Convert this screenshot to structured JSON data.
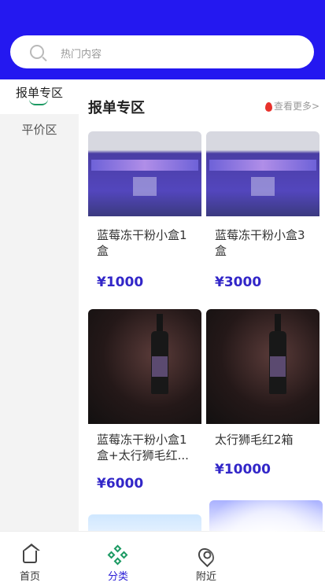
{
  "search": {
    "placeholder": "热门内容"
  },
  "sidebar": {
    "items": [
      {
        "label": "报单专区",
        "active": true
      },
      {
        "label": "平价区",
        "active": false
      }
    ]
  },
  "section": {
    "title": "报单专区",
    "more": "查看更多>"
  },
  "products": [
    {
      "title": "蓝莓冻干粉小盒1盒",
      "price": "¥1000"
    },
    {
      "title": "蓝莓冻干粉小盒3盒",
      "price": "¥3000"
    },
    {
      "title": "蓝莓冻干粉小盒1盒+太行狮毛红...",
      "price": "¥6000"
    },
    {
      "title": "太行狮毛红2箱",
      "price": "¥10000"
    }
  ],
  "tabbar": {
    "items": [
      {
        "label": "首页",
        "icon": "home-icon"
      },
      {
        "label": "分类",
        "icon": "category-icon",
        "active": true
      },
      {
        "label": "附近",
        "icon": "location-icon"
      }
    ]
  },
  "colors": {
    "primary": "#2418f0",
    "price": "#3226c8",
    "active_tab": "#2a1dd6",
    "accent_green": "#1c9a63"
  }
}
